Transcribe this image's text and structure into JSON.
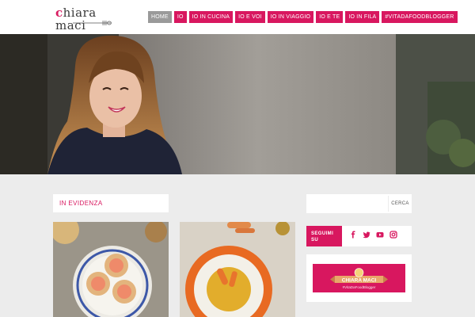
{
  "brand": {
    "logo_text": "hiara maci",
    "logo_initial": "c",
    "accent_color": "#d8175f"
  },
  "nav": {
    "items": [
      {
        "label": "HOME",
        "active": true
      },
      {
        "label": "IO",
        "active": false
      },
      {
        "label": "IO IN CUCINA",
        "active": false
      },
      {
        "label": "IO E VOI",
        "active": false
      },
      {
        "label": "IO IN VIAGGIO",
        "active": false
      },
      {
        "label": "IO E TE",
        "active": false
      },
      {
        "label": "IO IN FILA",
        "active": false
      },
      {
        "label": "#VITADAFOODBLOGGER",
        "active": false
      }
    ]
  },
  "main": {
    "featured_title": "IN EVIDENZA"
  },
  "sidebar": {
    "search": {
      "placeholder": "",
      "button_label": "CERCA"
    },
    "follow": {
      "label_line1": "SEGUIMI",
      "label_line2": "SU",
      "icons": [
        "facebook-icon",
        "twitter-icon",
        "youtube-icon",
        "instagram-icon"
      ]
    },
    "banner": {
      "title": "CHIARA MACI",
      "subtitle": "#VitaDaFoodBlogger"
    }
  }
}
